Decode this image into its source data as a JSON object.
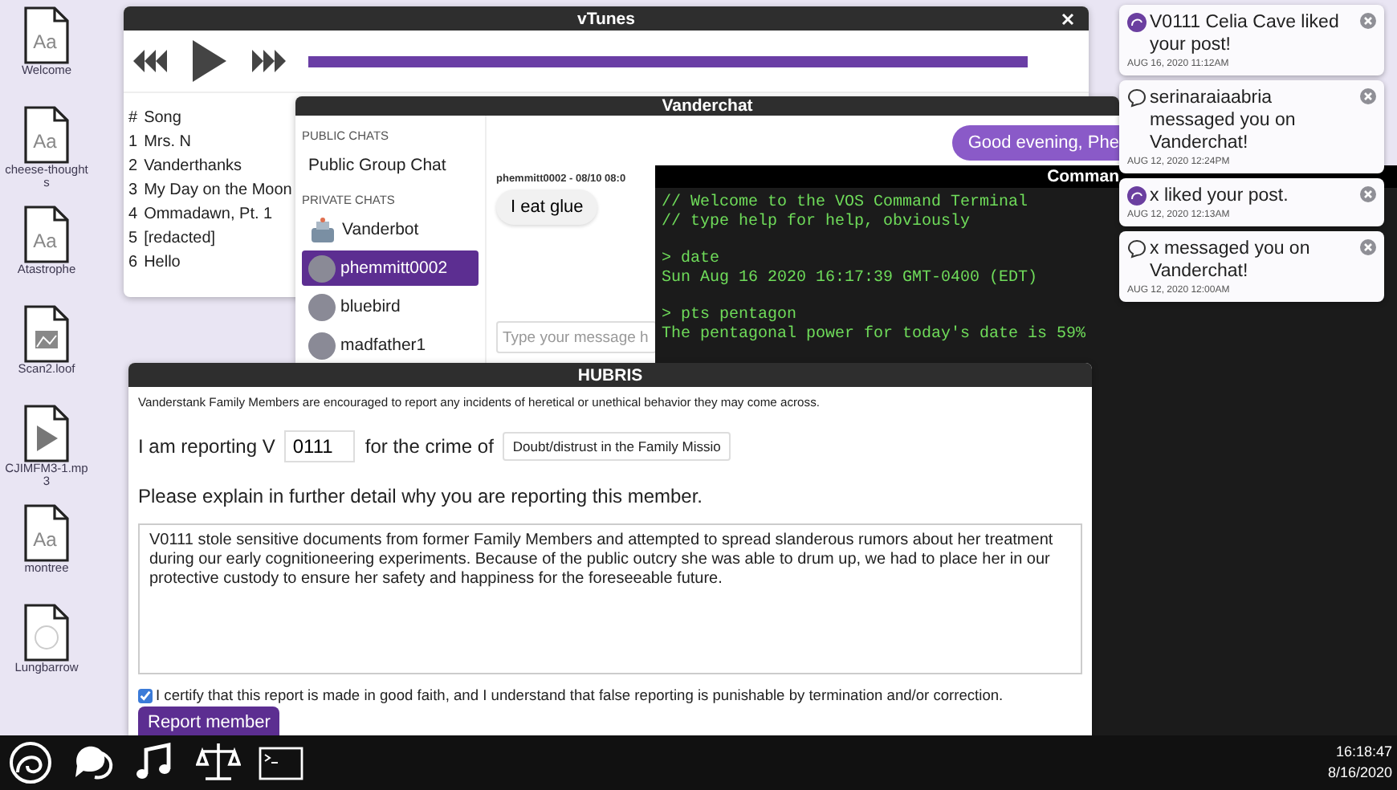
{
  "desktop_icons": [
    {
      "label": "Welcome",
      "kind": "font",
      "glyph": "Aa"
    },
    {
      "label": "cheese-thoughts",
      "kind": "font",
      "glyph": "Aa"
    },
    {
      "label": "Atastrophe",
      "kind": "font",
      "glyph": "Aa"
    },
    {
      "label": "Scan2.loof",
      "kind": "image"
    },
    {
      "label": "CJIMFM3-1.mp3",
      "kind": "audio"
    },
    {
      "label": "montree",
      "kind": "font",
      "glyph": "Aa"
    },
    {
      "label": "Lungbarrow",
      "kind": "logo"
    }
  ],
  "vtunes": {
    "title": "vTunes",
    "progress": {
      "level": 1
    },
    "columns": [
      "#",
      "Song"
    ],
    "songs": [
      {
        "number": "1",
        "title": "Mrs. N"
      },
      {
        "number": "2",
        "title": "Vanderthanks"
      },
      {
        "number": "3",
        "title": "My Day on the Moon"
      },
      {
        "number": "4",
        "title": "Ommadawn, Pt. 1"
      },
      {
        "number": "5",
        "title": "[redacted]"
      },
      {
        "number": "6",
        "title": "Hello"
      }
    ]
  },
  "vanderchat": {
    "title": "Vanderchat",
    "sections": [
      {
        "heading": "PUBLIC CHATS",
        "chats": [
          {
            "name": "Public Group Chat",
            "kind": "plain",
            "selected": false
          }
        ]
      },
      {
        "heading": "PRIVATE CHATS",
        "chats": [
          {
            "name": "Vanderbot",
            "kind": "robot",
            "selected": false
          },
          {
            "name": "phemmitt0002",
            "kind": "photo",
            "selected": true
          },
          {
            "name": "bluebird",
            "kind": "photo",
            "selected": false
          },
          {
            "name": "madfather1",
            "kind": "photo",
            "selected": false
          }
        ]
      }
    ],
    "messages": [
      {
        "kind": "sent",
        "text": "Good evening, Phe"
      },
      {
        "kind": "received",
        "meta": "phemmitt0002 - 08/10 08:0",
        "text": "I eat glue"
      }
    ],
    "input": {
      "placeholder": "Type your message h"
    }
  },
  "terminal": {
    "title": "Comman",
    "blocks": [
      [
        "// Welcome to the VOS Command Terminal",
        "// type help for help, obviously"
      ],
      [
        "> date",
        "Sun Aug 16 2020 16:17:39 GMT-0400 (EDT)"
      ],
      [
        "> pts pentagon",
        "The pentagonal power for today's date is 59%"
      ]
    ]
  },
  "hubris": {
    "title": "HUBRIS",
    "intro": "Vanderstank Family Members are encouraged to report any incidents of heretical or unethical behavior they may come across.",
    "report_prefix": "I am reporting V",
    "member_id": "0111",
    "crime_label": "for the crime of",
    "crime": "Doubt/distrust in the Family Missio",
    "prompt": "Please explain in further detail why you are reporting this member.",
    "report_text": "V0111 stole sensitive documents from former Family Members and attempted to spread slanderous rumors about her treatment during our early cognitioneering experiments. Because of the public outcry she was able to drum up, we had to place her in our protective custody to ensure her safety and happiness for the foreseeable future.",
    "certify": {
      "label": "I certify that this report is made in good faith, and I understand that false reporting is punishable by termination and/or correction.",
      "checked": true
    },
    "submit": "Report member"
  },
  "notifications": [
    {
      "kind": "like",
      "text": "V0111 Celia Cave liked your post!",
      "time": "AUG 16, 2020 11:12AM"
    },
    {
      "kind": "message",
      "text": "serinaraiaabria messaged you on Vanderchat!",
      "time": "AUG 12, 2020 12:24PM"
    },
    {
      "kind": "like",
      "text": "x liked your post.",
      "time": "AUG 12, 2020 12:13AM"
    },
    {
      "kind": "message",
      "text": "x messaged you on Vanderchat!",
      "time": "AUG 12, 2020 12:00AM"
    }
  ],
  "taskbar": {
    "apps": [
      {
        "kind": "logo"
      },
      {
        "kind": "chat"
      },
      {
        "kind": "music"
      },
      {
        "kind": "scales"
      },
      {
        "kind": "terminal"
      }
    ],
    "time": "16:18:47",
    "date": "8/16/2020"
  }
}
